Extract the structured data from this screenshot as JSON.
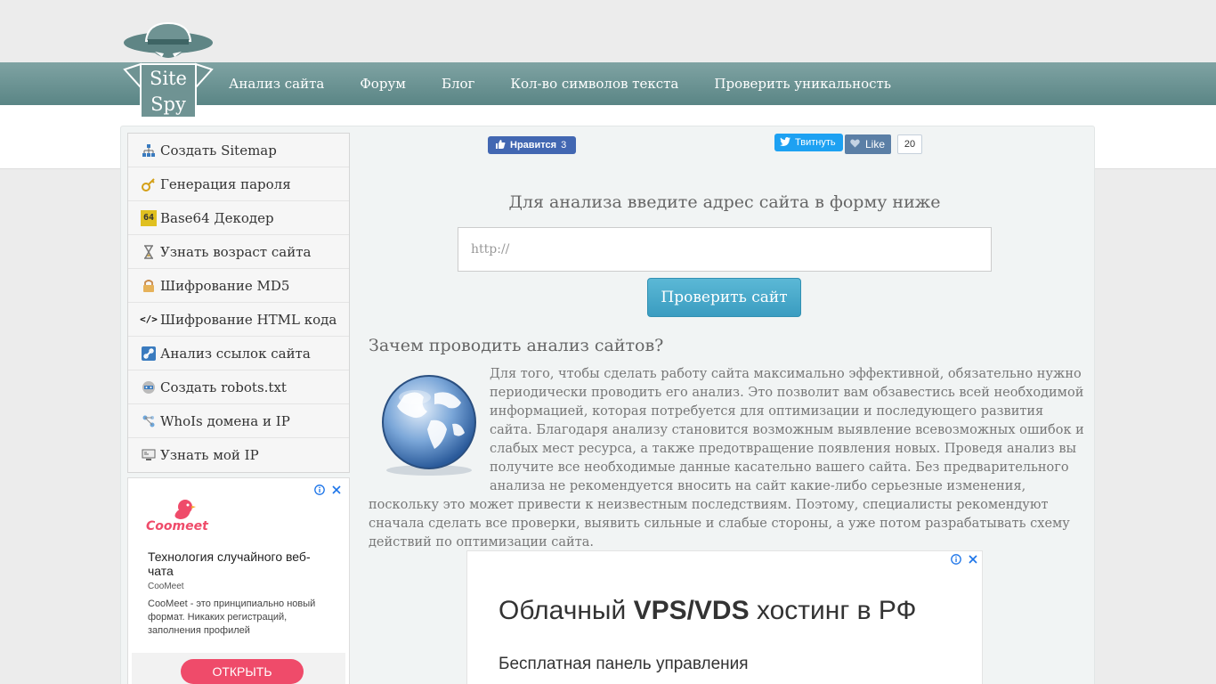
{
  "nav": {
    "items": [
      "Анализ сайта",
      "Форум",
      "Блог",
      "Кол-во символов текста",
      "Проверить уникальность"
    ]
  },
  "logo": {
    "line1": "Site",
    "line2": "Spy"
  },
  "sidebar": {
    "items": [
      {
        "label": "Создать Sitemap",
        "icon": "sitemap-icon"
      },
      {
        "label": "Генерация пароля",
        "icon": "key-icon"
      },
      {
        "label": "Base64 Декодер",
        "icon": "base64-icon",
        "icon_text": "64"
      },
      {
        "label": "Узнать возраст сайта",
        "icon": "hourglass-icon"
      },
      {
        "label": "Шифрование MD5",
        "icon": "lock-icon"
      },
      {
        "label": "Шифрование HTML кода",
        "icon": "code-icon",
        "icon_text": "</>"
      },
      {
        "label": "Анализ ссылок сайта",
        "icon": "link-icon"
      },
      {
        "label": "Создать robots.txt",
        "icon": "robot-icon"
      },
      {
        "label": "WhoIs домена и IP",
        "icon": "network-icon"
      },
      {
        "label": "Узнать мой IP",
        "icon": "monitor-icon"
      }
    ]
  },
  "ad_side": {
    "logo_text": "Coomeet",
    "title": "Технология случайного веб-чата",
    "brand": "CooMeet",
    "description": "CooMeet - это принципиально новый формат. Никаких регистраций, заполнения профилей",
    "cta": "ОТКРЫТЬ",
    "accent": "#ef4b6a"
  },
  "social": {
    "fb_label": "Нравится",
    "fb_count": "3",
    "tw_label": "Твитнуть",
    "vk_label": "Like",
    "vk_count": "20"
  },
  "form": {
    "title": "Для анализа введите адрес сайта в форму ниже",
    "placeholder": "http://",
    "button": "Проверить сайт"
  },
  "article": {
    "title": "Зачем проводить анализ сайтов?",
    "text": "Для того, чтобы сделать работу сайта максимально эффективной, обязательно нужно периодически проводить его анализ. Это позволит вам обзавестись всей необходимой информацией, которая потребуется для оптимизации и последующего развития сайта. Благодаря анализу становится возможным выявление всевозможных ошибок и слабых мест ресурса, а также предотвращение появления новых. Проведя анализ вы получите все необходимые данные касательно вашего сайта. Без предварительного анализа не рекомендуется вносить на сайт какие-либо серьезные изменения, поскольку это может привести к неизвестным последствиям. Поэтому, специалисты рекомендуют сначала сделать все проверки, выявить сильные и слабые стороны, а уже потом разрабатывать схему действий по оптимизации сайта."
  },
  "ad_main": {
    "heading_pre": "Облачный ",
    "heading_bold": "VPS/VDS",
    "heading_post": " хостинг в РФ",
    "sub": "Бесплатная панель управления"
  },
  "colors": {
    "navbar": "#6b9393",
    "button": "#46a8ca",
    "fb": "#4267b2",
    "twitter": "#1da1f2",
    "vk": "#5b7fa6"
  }
}
